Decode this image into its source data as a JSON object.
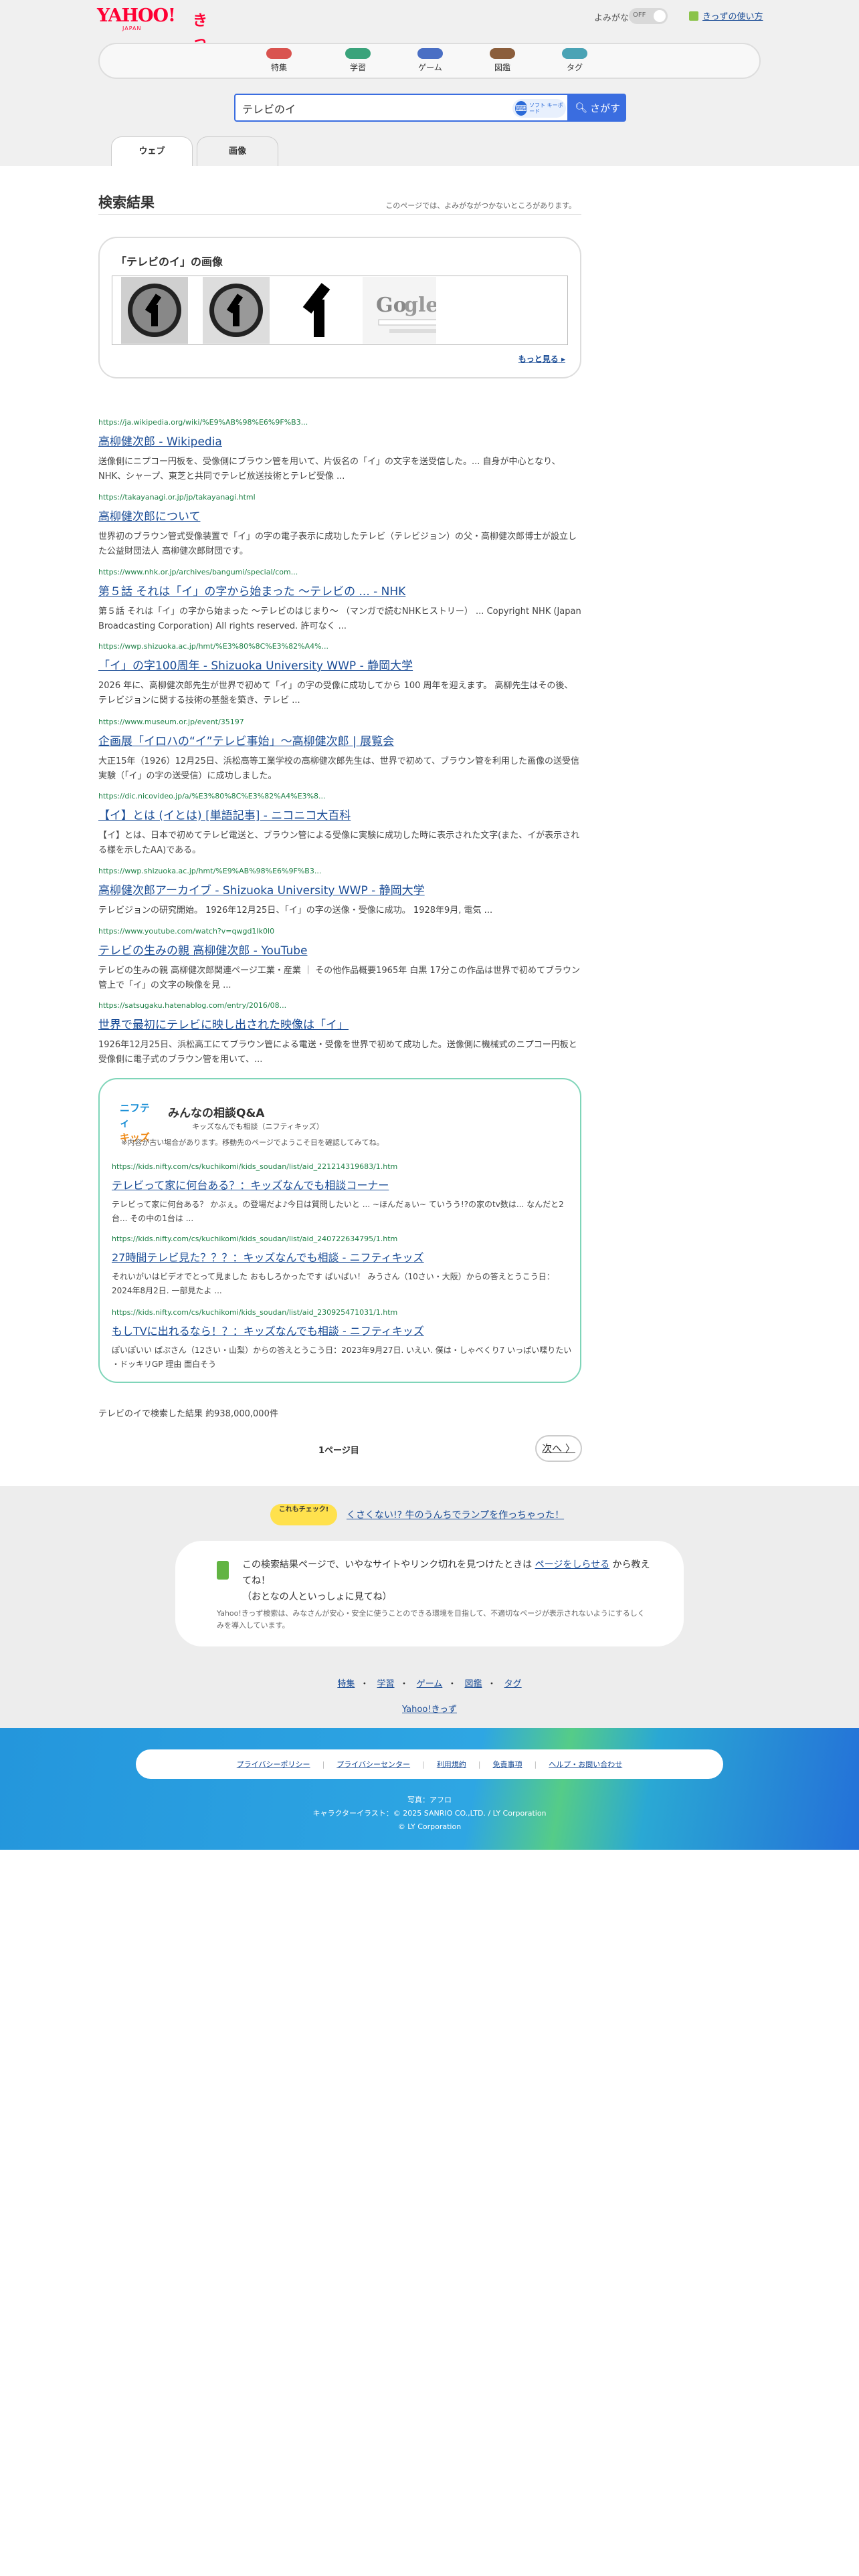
{
  "header": {
    "logo": "YAHOO!",
    "logo_kids": "きっず",
    "logo_sub": "JAPAN",
    "yomigana_label": "よみがな",
    "yomigana_state": "OFF",
    "howto_link": "きっずの使い方"
  },
  "nav": [
    {
      "label": "特集",
      "color": "#d9534f"
    },
    {
      "label": "学習",
      "color": "#3aa37b"
    },
    {
      "label": "ゲーム",
      "color": "#4a6fc4"
    },
    {
      "label": "図鑑",
      "color": "#8b5e3c"
    },
    {
      "label": "タグ",
      "color": "#4aa3b5"
    }
  ],
  "search": {
    "query": "テレビのイ",
    "keyboard_label": "ソフト キーボード",
    "button": "さがす"
  },
  "tabs": {
    "web": "ウェブ",
    "image": "画像"
  },
  "results_header": {
    "title": "検索結果",
    "note": "このページでは、よみがながつかないところがあります。"
  },
  "image_block": {
    "title": "「テレビのイ」の画像",
    "more": "もっと見る"
  },
  "results": [
    {
      "url": "https://ja.wikipedia.org/wiki/%E9%AB%98%E6%9F%B3...",
      "title": "高柳健次郎 - Wikipedia",
      "snippet": "送像側にニプコー円板を、受像側にブラウン管を用いて、片仮名の「イ」の文字を送受信した。... 自身が中心となり、NHK、シャープ、東芝と共同でテレビ放送技術とテレビ受像 ..."
    },
    {
      "url": "https://takayanagi.or.jp/jp/takayanagi.html",
      "title": "高柳健次郎について",
      "snippet": "世界初のブラウン管式受像装置で「イ」の字の電子表示に成功したテレビ（テレビジョン）の父・高柳健次郎博士が設立した公益財団法人 高柳健次郎財団です。"
    },
    {
      "url": "https://www.nhk.or.jp/archives/bangumi/special/com...",
      "title": "第５話 それは「イ」の字から始まった 〜テレビの ... - NHK",
      "snippet": "第５話 それは「イ」の字から始まった 〜テレビのはじまり〜 （マンガで読むNHKヒストリー） ... Copyright NHK (Japan Broadcasting Corporation) All rights reserved. 許可なく ..."
    },
    {
      "url": "https://wwp.shizuoka.ac.jp/hmt/%E3%80%8C%E3%82%A4%...",
      "title": "「イ」の字100周年 - Shizuoka University WWP - 静岡大学",
      "snippet": "2026 年に、高柳健次郎先生が世界で初めて「イ」の字の受像に成功してから 100 周年を迎えます。 高柳先生はその後、テレビジョンに関する技術の基盤を築き、テレビ ..."
    },
    {
      "url": "https://www.museum.or.jp/event/35197",
      "title": "企画展「イロハの“イ”テレビ事始」〜高柳健次郎 | 展覧会",
      "snippet": "大正15年（1926）12月25日、浜松高等工業学校の高柳健次郎先生は、世界で初めて、ブラウン管を利用した画像の送受信実験（「イ」の字の送受信）に成功しました。"
    },
    {
      "url": "https://dic.nicovideo.jp/a/%E3%80%8C%E3%82%A4%E3%8...",
      "title": "【イ】とは (イとは) [単語記事] - ニコニコ大百科",
      "snippet": "【イ】とは、日本で初めてテレビ電送と、ブラウン管による受像に実験に成功した時に表示された文字(また、イが表示される様を示したAA)である。"
    },
    {
      "url": "https://wwp.shizuoka.ac.jp/hmt/%E9%AB%98%E6%9F%B3...",
      "title": "高柳健次郎アーカイブ - Shizuoka University WWP - 静岡大学",
      "snippet": "テレビジョンの研究開始。 1926年12月25日、「イ」の字の送像・受像に成功。 1928年9月, 電気 ..."
    },
    {
      "url": "https://www.youtube.com/watch?v=qwgd1Ik0l0",
      "title": "テレビの生みの親 高柳健次郎 - YouTube",
      "snippet": "テレビの生みの親 高柳健次郎関連ページ工業・産業 ｜ その他作品概要1965年 白黒 17分この作品は世界で初めてブラウン管上で「イ」の文字の映像を見 ..."
    },
    {
      "url": "https://satsugaku.hatenablog.com/entry/2016/08...",
      "title": "世界で最初にテレビに映し出された映像は「イ」",
      "snippet": "1926年12月25日、浜松高工にてブラウン管による電送・受像を世界で初めて成功した。送像側に機械式のニプコー円板と受像側に電子式のブラウン管を用いて、..."
    }
  ],
  "qa": {
    "logo_top": "ニフティ",
    "logo_bottom": "キッズ",
    "title": "みんなの相談Q&A",
    "subtitle": "キッズなんでも相談（ニフティキッズ）",
    "note": "※内容が古い場合があります。移動先のページでようこそ日を確認してみてね。",
    "items": [
      {
        "url": "https://kids.nifty.com/cs/kuchikomi/kids_soudan/list/aid_221214319683/1.htm",
        "title": "テレビって家に何台ある？：キッズなんでも相談コーナー",
        "snippet": "テレビって家に何台ある？ かぶぇ。の登場だよ♪今日は質問したいと ... ~ほんだぁい~ ていうう!?の家のtv数は... なんだと2台... その中の1台は ..."
      },
      {
        "url": "https://kids.nifty.com/cs/kuchikomi/kids_soudan/list/aid_240722634795/1.htm",
        "title": "27時間テレビ見た？？？：キッズなんでも相談 - ニフティキッズ",
        "snippet": "それいがいはビデオでとって見ました おもしろかったです ぱいぱい！ みうさん（10さい・大阪）からの答えとうこう日：2024年8月2日. 一部見たよ ..."
      },
      {
        "url": "https://kids.nifty.com/cs/kuchikomi/kids_soudan/list/aid_230925471031/1.htm",
        "title": "もしTVに出れるなら！？：キッズなんでも相談 - ニフティキッズ",
        "snippet": "ぽいぽいい ぱぷさん（12さい・山梨）からの答えとうこう日：2023年9月27日. いえい. 僕は・しゃべくり7 いっぱい喋りたい ・ドッキリGP 理由 面白そう"
      }
    ]
  },
  "total": "テレビのイで検索した結果 約938,000,000件",
  "pagination": {
    "page": "1ページ目",
    "next": "次へ"
  },
  "promo": {
    "badge": "これもチェック!",
    "link": "くさくない!? 牛のうんちでランプを作っちゃった！"
  },
  "report": {
    "text_before": "この検索結果ページで、いやなサイトやリンク切れを見つけたときは",
    "link": "ページをしらせる",
    "text_after": "から教えてね！",
    "text2": "（おとなの人といっしょに見てね）",
    "note": "Yahoo!きっず検索は、みなさんが安心・安全に使うことのできる環境を目指して、不適切なページが表示されないようにするしくみを導入しています。"
  },
  "footer_nav": [
    "特集",
    "学習",
    "ゲーム",
    "図鑑",
    "タグ"
  ],
  "footer_yahoo": "Yahoo!きっず",
  "footer_links": [
    "プライバシーポリシー",
    "プライバシーセンター",
    "利用規約",
    "免責事項",
    "ヘルプ・お問い合わせ"
  ],
  "credits": [
    "写真：アフロ",
    "キャラクターイラスト：© 2025 SANRIO CO.,LTD. / LY Corporation",
    "© LY Corporation"
  ]
}
